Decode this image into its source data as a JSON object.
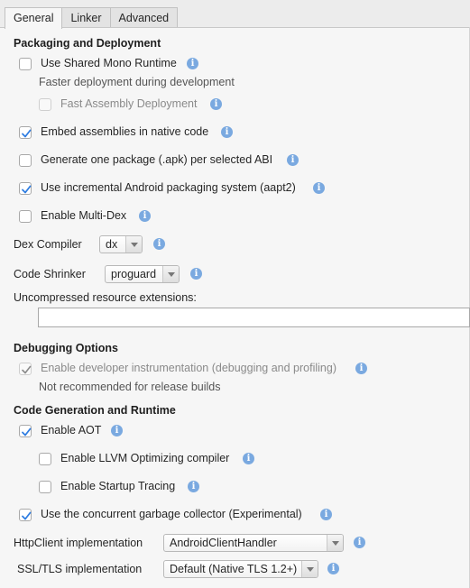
{
  "tabs": [
    {
      "label": "General",
      "active": true
    },
    {
      "label": "Linker",
      "active": false
    },
    {
      "label": "Advanced",
      "active": false
    }
  ],
  "packaging": {
    "heading": "Packaging and Deployment",
    "shared_mono": {
      "label": "Use Shared Mono Runtime",
      "checked": false
    },
    "shared_mono_note": "Faster deployment during development",
    "fast_assembly": {
      "label": "Fast Assembly Deployment",
      "checked": false,
      "enabled": false
    },
    "embed_assemblies": {
      "label": "Embed assemblies in native code",
      "checked": true
    },
    "one_package": {
      "label": "Generate one package (.apk) per selected ABI",
      "checked": false
    },
    "aapt2": {
      "label": "Use incremental Android packaging system (aapt2)",
      "checked": true
    },
    "multidex": {
      "label": "Enable Multi-Dex",
      "checked": false
    },
    "dex_compiler": {
      "label": "Dex Compiler",
      "value": "dx"
    },
    "code_shrinker": {
      "label": "Code Shrinker",
      "value": "proguard"
    },
    "uncompressed": {
      "label": "Uncompressed resource extensions:",
      "value": ""
    }
  },
  "debugging": {
    "heading": "Debugging Options",
    "instrumentation": {
      "label": "Enable developer instrumentation (debugging and profiling)",
      "checked": true,
      "enabled": false
    },
    "note": "Not recommended for release builds"
  },
  "codegen": {
    "heading": "Code Generation and Runtime",
    "aot": {
      "label": "Enable AOT",
      "checked": true
    },
    "llvm": {
      "label": "Enable LLVM Optimizing compiler",
      "checked": false
    },
    "startup_tracing": {
      "label": "Enable Startup Tracing",
      "checked": false
    },
    "concurrent_gc": {
      "label": "Use the concurrent garbage collector (Experimental)",
      "checked": true
    },
    "httpclient": {
      "label": "HttpClient implementation",
      "value": "AndroidClientHandler"
    },
    "ssl": {
      "label": "SSL/TLS implementation",
      "value": "Default (Native TLS 1.2+)"
    }
  },
  "colors": {
    "accent": "#2f7de1",
    "info": "#7aa9e0"
  },
  "icon_info": "i"
}
